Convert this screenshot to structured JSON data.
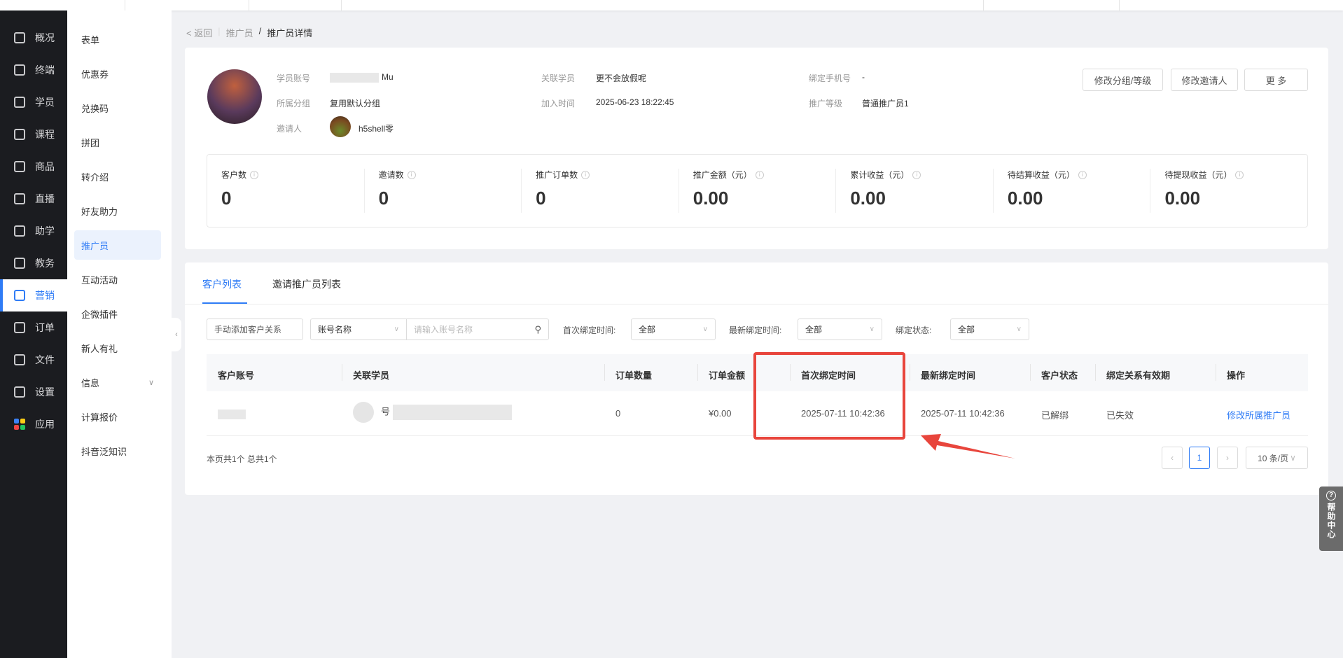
{
  "nav": [
    {
      "label": "概况",
      "icon": "dashboard-icon"
    },
    {
      "label": "终端",
      "icon": "store-icon"
    },
    {
      "label": "学员",
      "icon": "users-icon"
    },
    {
      "label": "课程",
      "icon": "course-icon"
    },
    {
      "label": "商品",
      "icon": "goods-icon"
    },
    {
      "label": "直播",
      "icon": "live-icon"
    },
    {
      "label": "助学",
      "icon": "study-icon"
    },
    {
      "label": "教务",
      "icon": "academic-icon"
    },
    {
      "label": "营销",
      "icon": "marketing-icon",
      "active": true
    },
    {
      "label": "订单",
      "icon": "order-icon"
    },
    {
      "label": "文件",
      "icon": "folder-icon"
    },
    {
      "label": "设置",
      "icon": "settings-icon"
    },
    {
      "label": "应用",
      "icon": "apps-icon"
    }
  ],
  "subnav": [
    "表单",
    "优惠券",
    "兑换码",
    "拼团",
    "转介绍",
    "好友助力",
    "推广员",
    "互动活动",
    "企微插件",
    "新人有礼",
    "信息",
    "计算报价",
    "抖音泛知识"
  ],
  "breadcrumb": {
    "back": "< 返回",
    "parent": "推广员",
    "sep": "/",
    "current": "推广员详情"
  },
  "profile": {
    "account_label": "学员账号",
    "account_value": "Mu",
    "group_label": "所属分组",
    "group_value": "复用默认分组",
    "inviter_label": "邀请人",
    "inviter_value": "h5shell零",
    "linked_label": "关联学员",
    "linked_value": "更不会放假呢",
    "join_label": "加入时间",
    "join_value": "2025-06-23 18:22:45",
    "phone_label": "绑定手机号",
    "phone_value": "-",
    "level_label": "推广等级",
    "level_value": "普通推广员1"
  },
  "actions": {
    "edit_group": "修改分组/等级",
    "edit_inviter": "修改邀请人",
    "more": "更 多"
  },
  "stats": [
    {
      "label": "客户数",
      "value": "0"
    },
    {
      "label": "邀请数",
      "value": "0"
    },
    {
      "label": "推广订单数",
      "value": "0"
    },
    {
      "label": "推广金额（元）",
      "value": "0.00"
    },
    {
      "label": "累计收益（元）",
      "value": "0.00"
    },
    {
      "label": "待结算收益（元）",
      "value": "0.00"
    },
    {
      "label": "待提现收益（元）",
      "value": "0.00"
    }
  ],
  "tabs": [
    "客户列表",
    "邀请推广员列表"
  ],
  "filters": {
    "add_button": "手动添加客户关系",
    "account_select": "账号名称",
    "search_placeholder": "请输入账号名称",
    "first_bind_label": "首次绑定时间:",
    "first_bind_value": "全部",
    "latest_bind_label": "最新绑定时间:",
    "latest_bind_value": "全部",
    "status_label": "绑定状态:",
    "status_value": "全部"
  },
  "table": {
    "columns": [
      "客户账号",
      "关联学员",
      "订单数量",
      "订单金额",
      "首次绑定时间",
      "最新绑定时间",
      "客户状态",
      "绑定关系有效期",
      "操作"
    ],
    "rows": [
      {
        "account": "",
        "student": "号",
        "orders": "0",
        "amount": "¥0.00",
        "first_bind": "2025-07-11 10:42:36",
        "latest_bind": "2025-07-11 10:42:36",
        "status": "已解绑",
        "validity": "已失效",
        "action": "修改所属推广员"
      }
    ]
  },
  "footer": {
    "summary": "本页共1个 总共1个",
    "page": "1",
    "page_size": "10 条/页"
  },
  "help": "帮助中心",
  "colors": {
    "accent": "#2f7cf6",
    "highlight": "#e8453c",
    "sidebar": "#1b1c20"
  }
}
